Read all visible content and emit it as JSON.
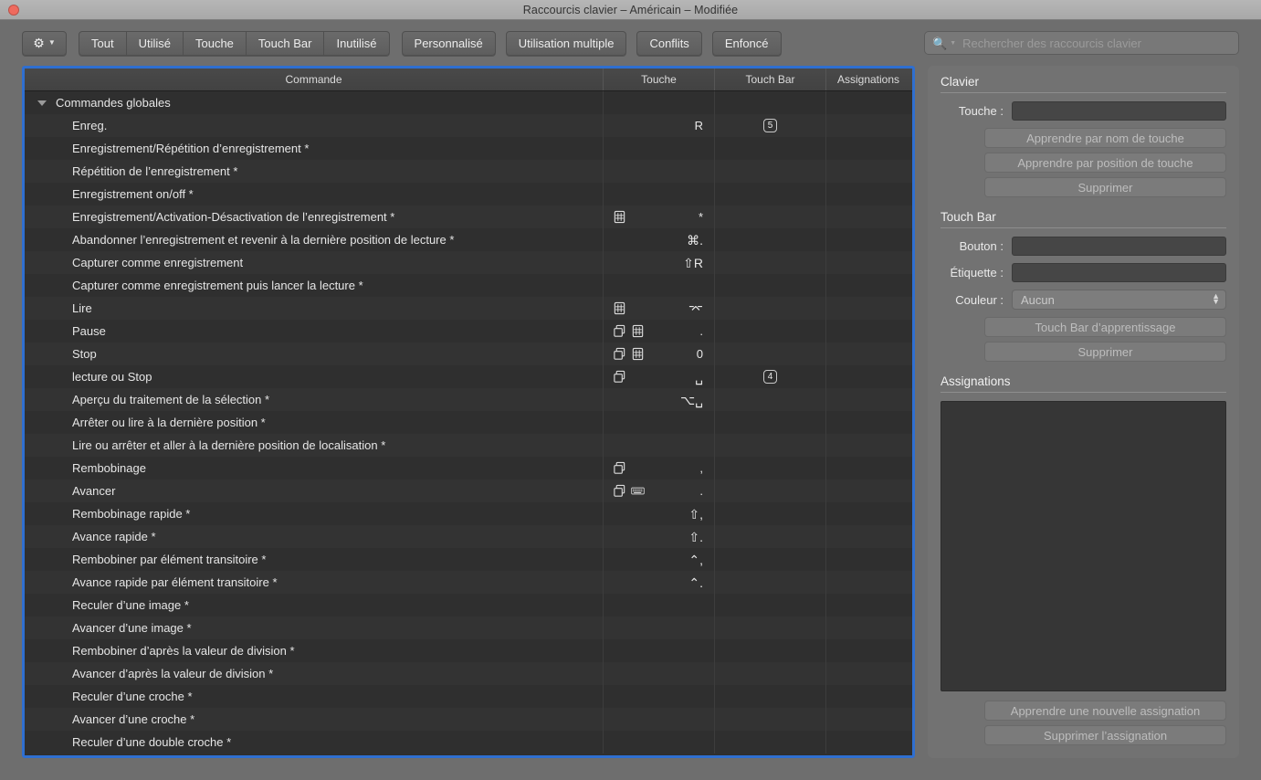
{
  "window": {
    "title": "Raccourcis clavier – Américain – Modifiée",
    "close_button": "close"
  },
  "toolbar": {
    "gear_icon": "gear-icon",
    "gear_chevron": "chevron-down-icon",
    "filters": [
      "Tout",
      "Utilisé",
      "Touche",
      "Touch Bar",
      "Inutilisé"
    ],
    "personnalise": "Personnalisé",
    "utilisation_multiple": "Utilisation multiple",
    "conflits": "Conflits",
    "enfonce": "Enfoncé"
  },
  "search": {
    "icon": "search-icon",
    "chevron": "chevron-down-icon",
    "placeholder": "Rechercher des raccourcis clavier",
    "value": ""
  },
  "table": {
    "columns": [
      "Commande",
      "Touche",
      "Touch Bar",
      "Assignations"
    ],
    "group": {
      "label": "Commandes globales",
      "expanded": true
    },
    "rows": [
      {
        "command": "Enreg.",
        "icons": [],
        "key": "R",
        "touchbar": "5",
        "assignations": ""
      },
      {
        "command": "Enregistrement/Répétition d’enregistrement  *",
        "icons": [],
        "key": "",
        "touchbar": "",
        "assignations": ""
      },
      {
        "command": "Répétition de l’enregistrement *",
        "icons": [],
        "key": "",
        "touchbar": "",
        "assignations": ""
      },
      {
        "command": "Enregistrement on/off *",
        "icons": [],
        "key": "",
        "touchbar": "",
        "assignations": ""
      },
      {
        "command": "Enregistrement/Activation-Désactivation de l’enregistrement *",
        "icons": [
          "numpad-icon"
        ],
        "key": "*",
        "touchbar": "",
        "assignations": ""
      },
      {
        "command": "Abandonner l’enregistrement et revenir à la dernière position de lecture *",
        "icons": [],
        "key": "⌘.",
        "touchbar": "",
        "assignations": ""
      },
      {
        "command": "Capturer comme enregistrement",
        "icons": [],
        "key": "⇧R",
        "touchbar": "",
        "assignations": ""
      },
      {
        "command": "Capturer comme enregistrement puis lancer la lecture *",
        "icons": [],
        "key": "",
        "touchbar": "",
        "assignations": ""
      },
      {
        "command": "Lire",
        "icons": [
          "numpad-icon"
        ],
        "key": "⌤",
        "touchbar": "",
        "assignations": ""
      },
      {
        "command": "Pause",
        "icons": [
          "windows-icon",
          "numpad-icon"
        ],
        "key": ".",
        "touchbar": "",
        "assignations": ""
      },
      {
        "command": "Stop",
        "icons": [
          "windows-icon",
          "numpad-icon"
        ],
        "key": "0",
        "touchbar": "",
        "assignations": ""
      },
      {
        "command": "lecture ou Stop",
        "icons": [
          "windows-icon"
        ],
        "key": "␣",
        "touchbar": "4",
        "assignations": ""
      },
      {
        "command": "Aperçu du traitement de la sélection *",
        "icons": [],
        "key": "⌥␣",
        "touchbar": "",
        "assignations": ""
      },
      {
        "command": "Arrêter ou lire à la dernière position *",
        "icons": [],
        "key": "",
        "touchbar": "",
        "assignations": ""
      },
      {
        "command": "Lire ou arrêter et aller à la dernière position de localisation *",
        "icons": [],
        "key": "",
        "touchbar": "",
        "assignations": ""
      },
      {
        "command": "Rembobinage",
        "icons": [
          "windows-icon"
        ],
        "key": ",",
        "touchbar": "",
        "assignations": ""
      },
      {
        "command": "Avancer",
        "icons": [
          "windows-icon",
          "keyboard-icon"
        ],
        "key": ".",
        "touchbar": "",
        "assignations": ""
      },
      {
        "command": "Rembobinage rapide *",
        "icons": [],
        "key": "⇧,",
        "touchbar": "",
        "assignations": ""
      },
      {
        "command": "Avance rapide *",
        "icons": [],
        "key": "⇧.",
        "touchbar": "",
        "assignations": ""
      },
      {
        "command": "Rembobiner par élément transitoire *",
        "icons": [],
        "key": "⌃,",
        "touchbar": "",
        "assignations": ""
      },
      {
        "command": "Avance rapide par élément transitoire *",
        "icons": [],
        "key": "⌃.",
        "touchbar": "",
        "assignations": ""
      },
      {
        "command": "Reculer d’une image *",
        "icons": [],
        "key": "",
        "touchbar": "",
        "assignations": ""
      },
      {
        "command": "Avancer d’une image *",
        "icons": [],
        "key": "",
        "touchbar": "",
        "assignations": ""
      },
      {
        "command": "Rembobiner d’après la valeur de division *",
        "icons": [],
        "key": "",
        "touchbar": "",
        "assignations": ""
      },
      {
        "command": "Avancer d’après la valeur de division *",
        "icons": [],
        "key": "",
        "touchbar": "",
        "assignations": ""
      },
      {
        "command": "Reculer d’une croche *",
        "icons": [],
        "key": "",
        "touchbar": "",
        "assignations": ""
      },
      {
        "command": "Avancer d’une croche *",
        "icons": [],
        "key": "",
        "touchbar": "",
        "assignations": ""
      },
      {
        "command": "Reculer d’une double croche *",
        "icons": [],
        "key": "",
        "touchbar": "",
        "assignations": ""
      }
    ]
  },
  "sidebar": {
    "clavier": {
      "title": "Clavier",
      "touche_label": "Touche :",
      "touche_value": "",
      "btn_nom": "Apprendre par nom de touche",
      "btn_position": "Apprendre par position de touche",
      "btn_supprimer": "Supprimer"
    },
    "touchbar": {
      "title": "Touch Bar",
      "bouton_label": "Bouton :",
      "bouton_value": "",
      "etiquette_label": "Étiquette :",
      "etiquette_value": "",
      "couleur_label": "Couleur :",
      "couleur_value": "Aucun",
      "btn_apprentissage": "Touch Bar d’apprentissage",
      "btn_supprimer": "Supprimer"
    },
    "assignations": {
      "title": "Assignations",
      "btn_apprendre": "Apprendre une nouvelle assignation",
      "btn_supprimer": "Supprimer l’assignation"
    }
  },
  "colors": {
    "focus_ring": "#2f6fd0",
    "window_chrome": "#6e6e6e",
    "table_bg": "#2e2e2e",
    "panel_bg": "#727272"
  }
}
